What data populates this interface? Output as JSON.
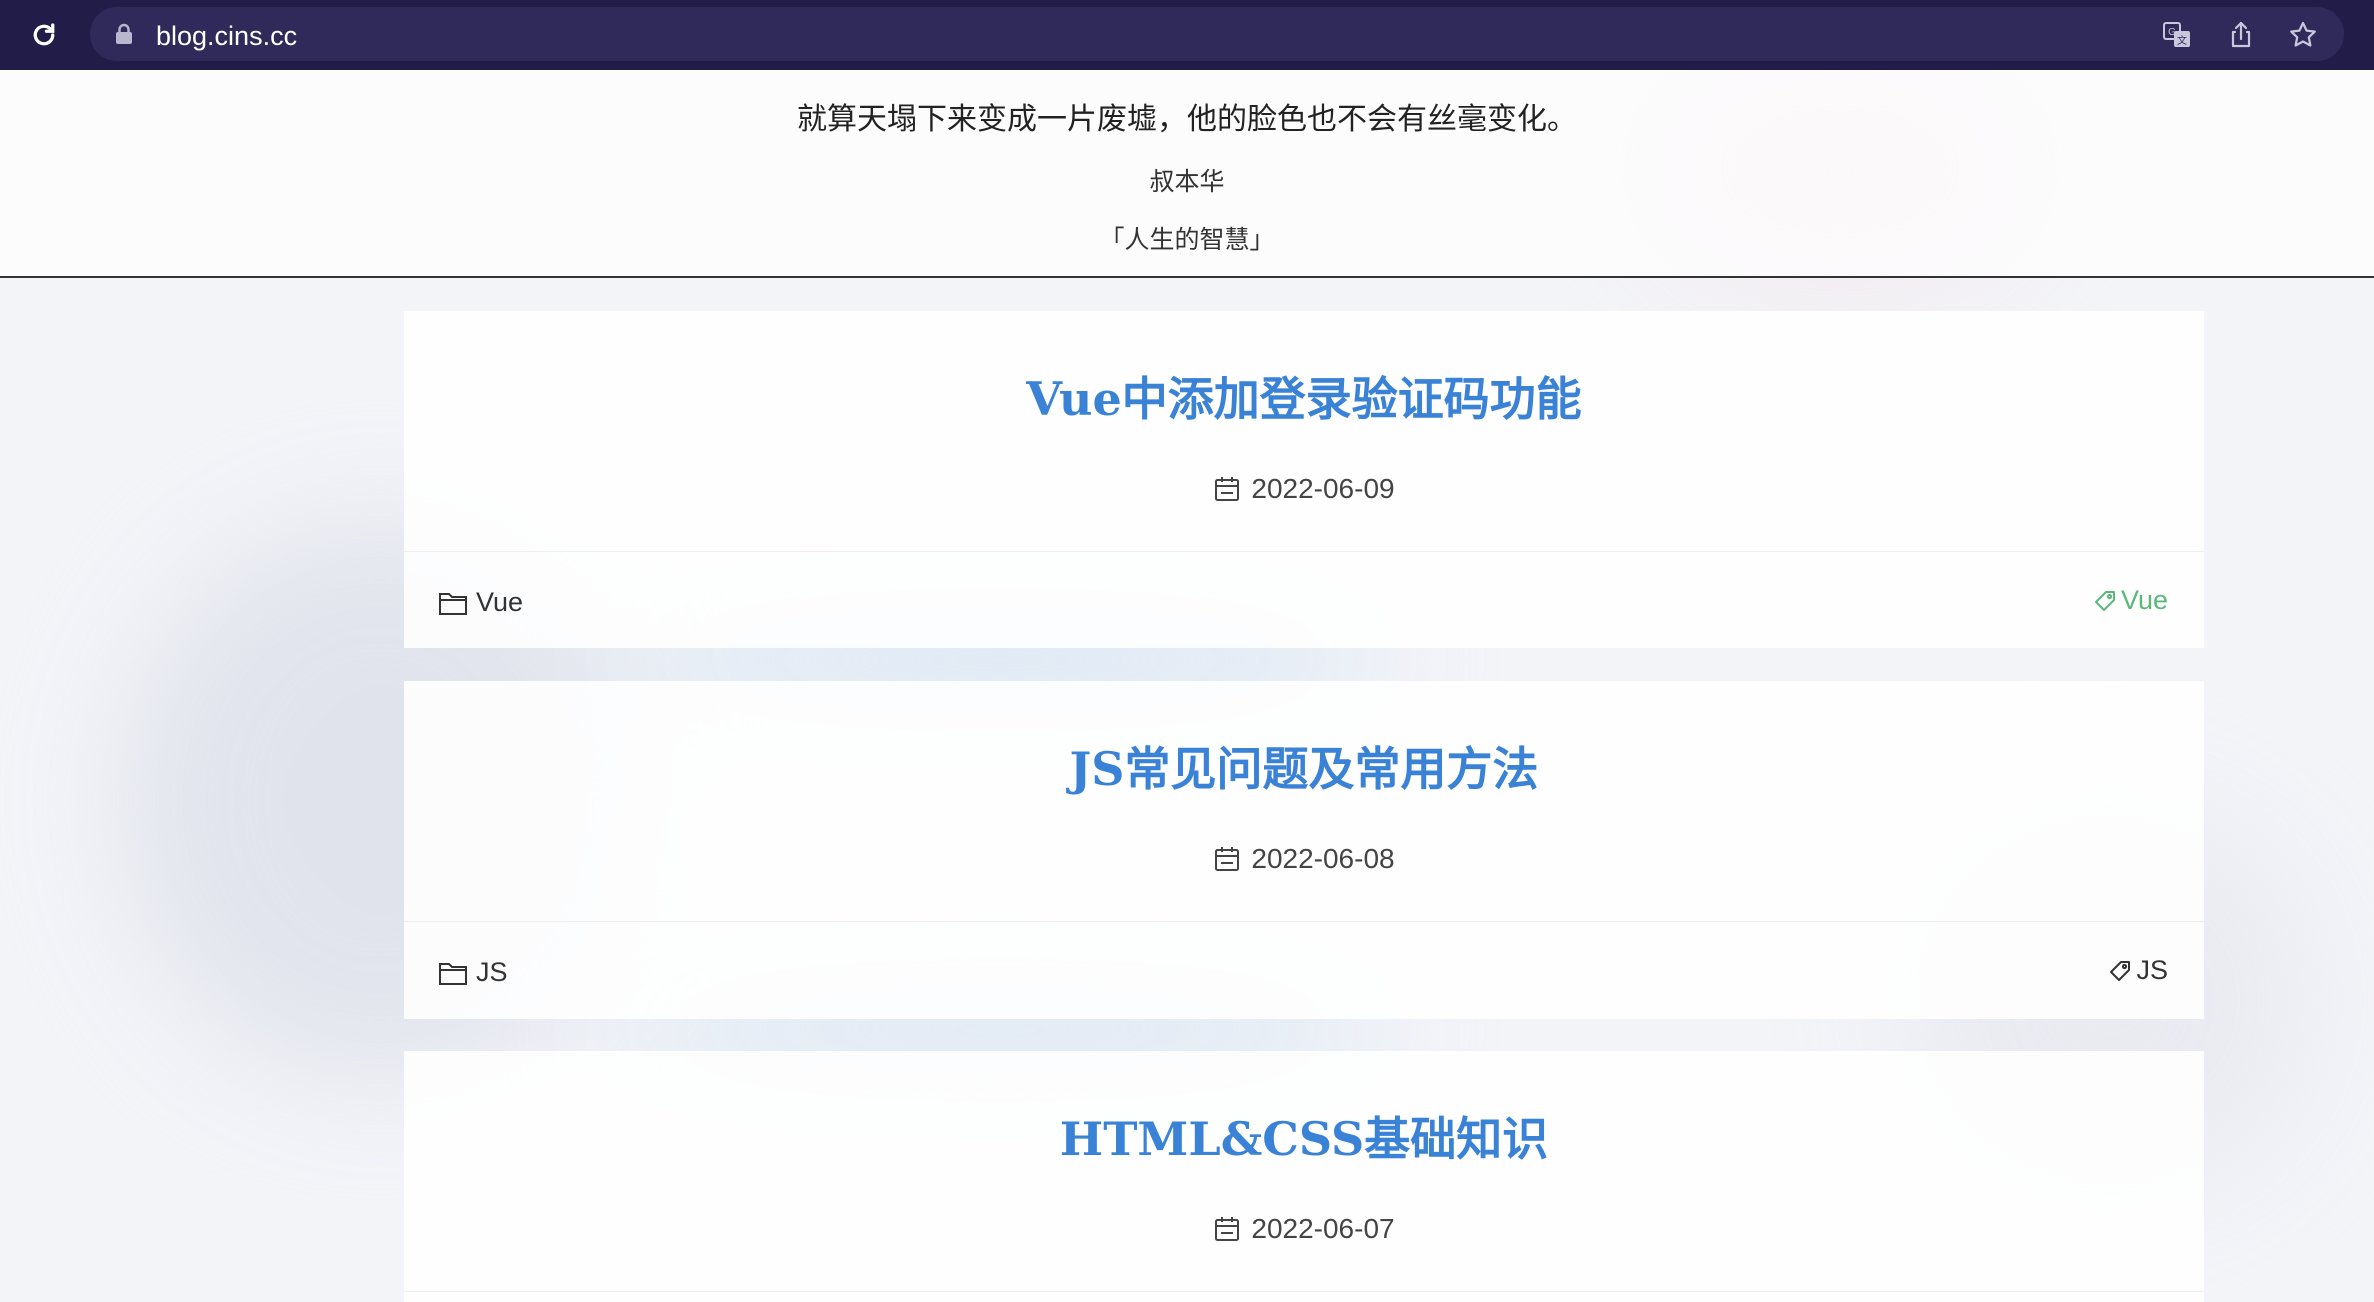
{
  "browser": {
    "url": "blog.cins.cc",
    "icons": [
      "reload-icon",
      "lock-icon",
      "translate-icon",
      "share-icon",
      "star-icon"
    ]
  },
  "quote": {
    "text": "就算天塌下来变成一片废墟，他的脸色也不会有丝毫变化。",
    "author": "叔本华",
    "source": "「人生的智慧」"
  },
  "posts": [
    {
      "title": "Vue中添加登录验证码功能",
      "date": "2022-06-09",
      "category": "Vue",
      "tag": "Vue",
      "tag_color": "#5cb87a"
    },
    {
      "title": "JS常见问题及常用方法",
      "date": "2022-06-08",
      "category": "JS",
      "tag": "JS",
      "tag_color": "#333333"
    },
    {
      "title": "HTML&CSS基础知识",
      "date": "2022-06-07"
    }
  ],
  "colors": {
    "title": "#3a82d6",
    "browser_bar": "#221c49",
    "url_box": "#2f2a59"
  }
}
